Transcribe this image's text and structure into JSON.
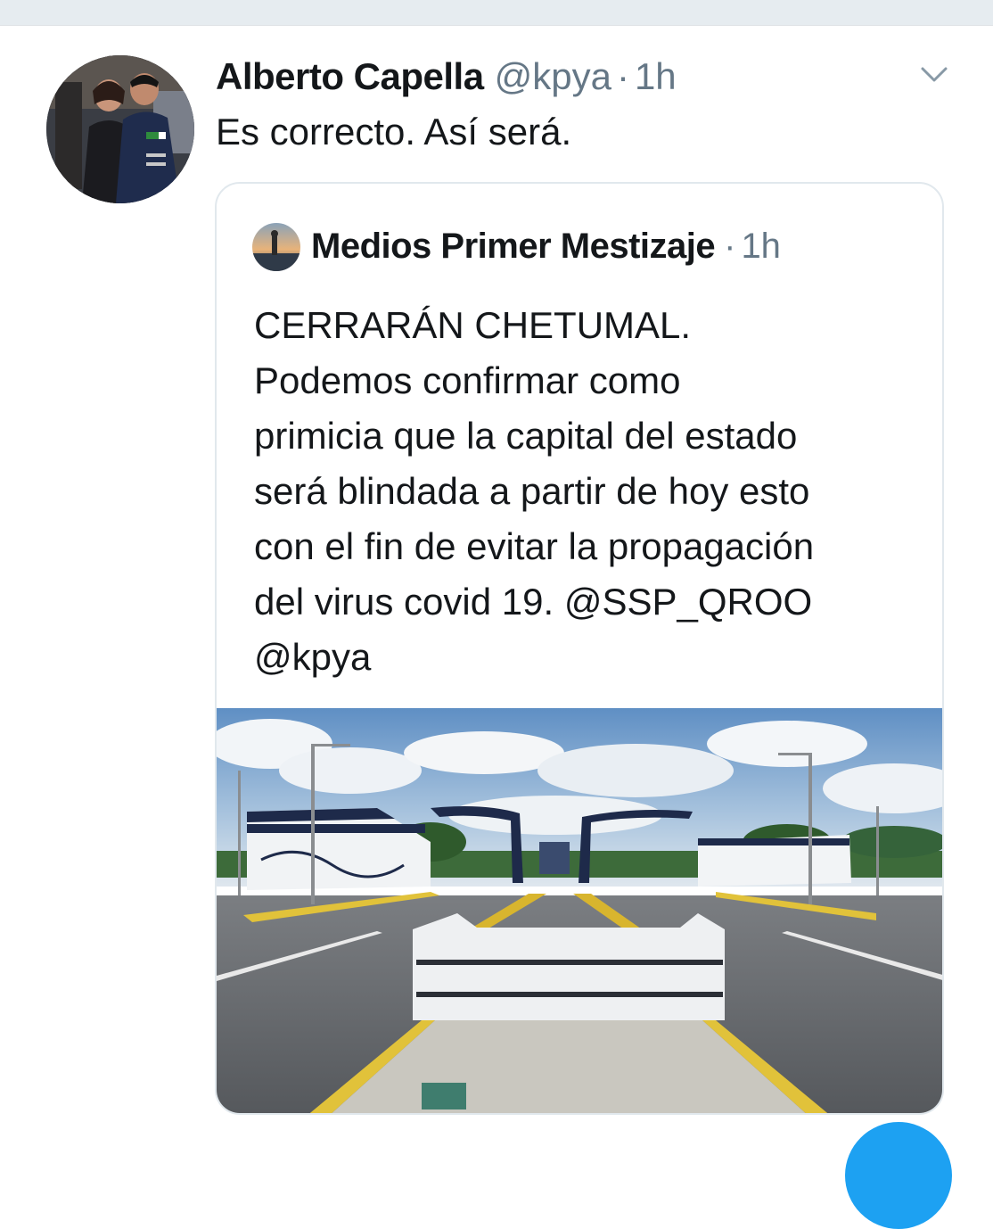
{
  "tweet": {
    "author_name": "Alberto Capella",
    "author_handle": "@kpya",
    "separator": "·",
    "timestamp": "1h",
    "text": "Es correcto. Así será."
  },
  "icons": {
    "menu": "chevron-down-icon",
    "avatar": "profile-photo"
  },
  "quoted_tweet": {
    "author_name": "Medios Primer Mestizaje",
    "separator": "·",
    "timestamp": "1h",
    "lines": [
      "CERRARÁN CHETUMAL.",
      "Podemos confirmar como",
      "primicia que la capital del estado",
      "será blindada a partir de hoy esto",
      "con el fin de evitar la propagación",
      "del virus covid 19. @SSP_QROO",
      "@kpya"
    ],
    "media": "photo"
  },
  "colors": {
    "text": "#14171a",
    "secondary": "#657786",
    "border": "#e1e8ed",
    "accent": "#1da1f2",
    "top_bar": "#e6ecf0"
  }
}
